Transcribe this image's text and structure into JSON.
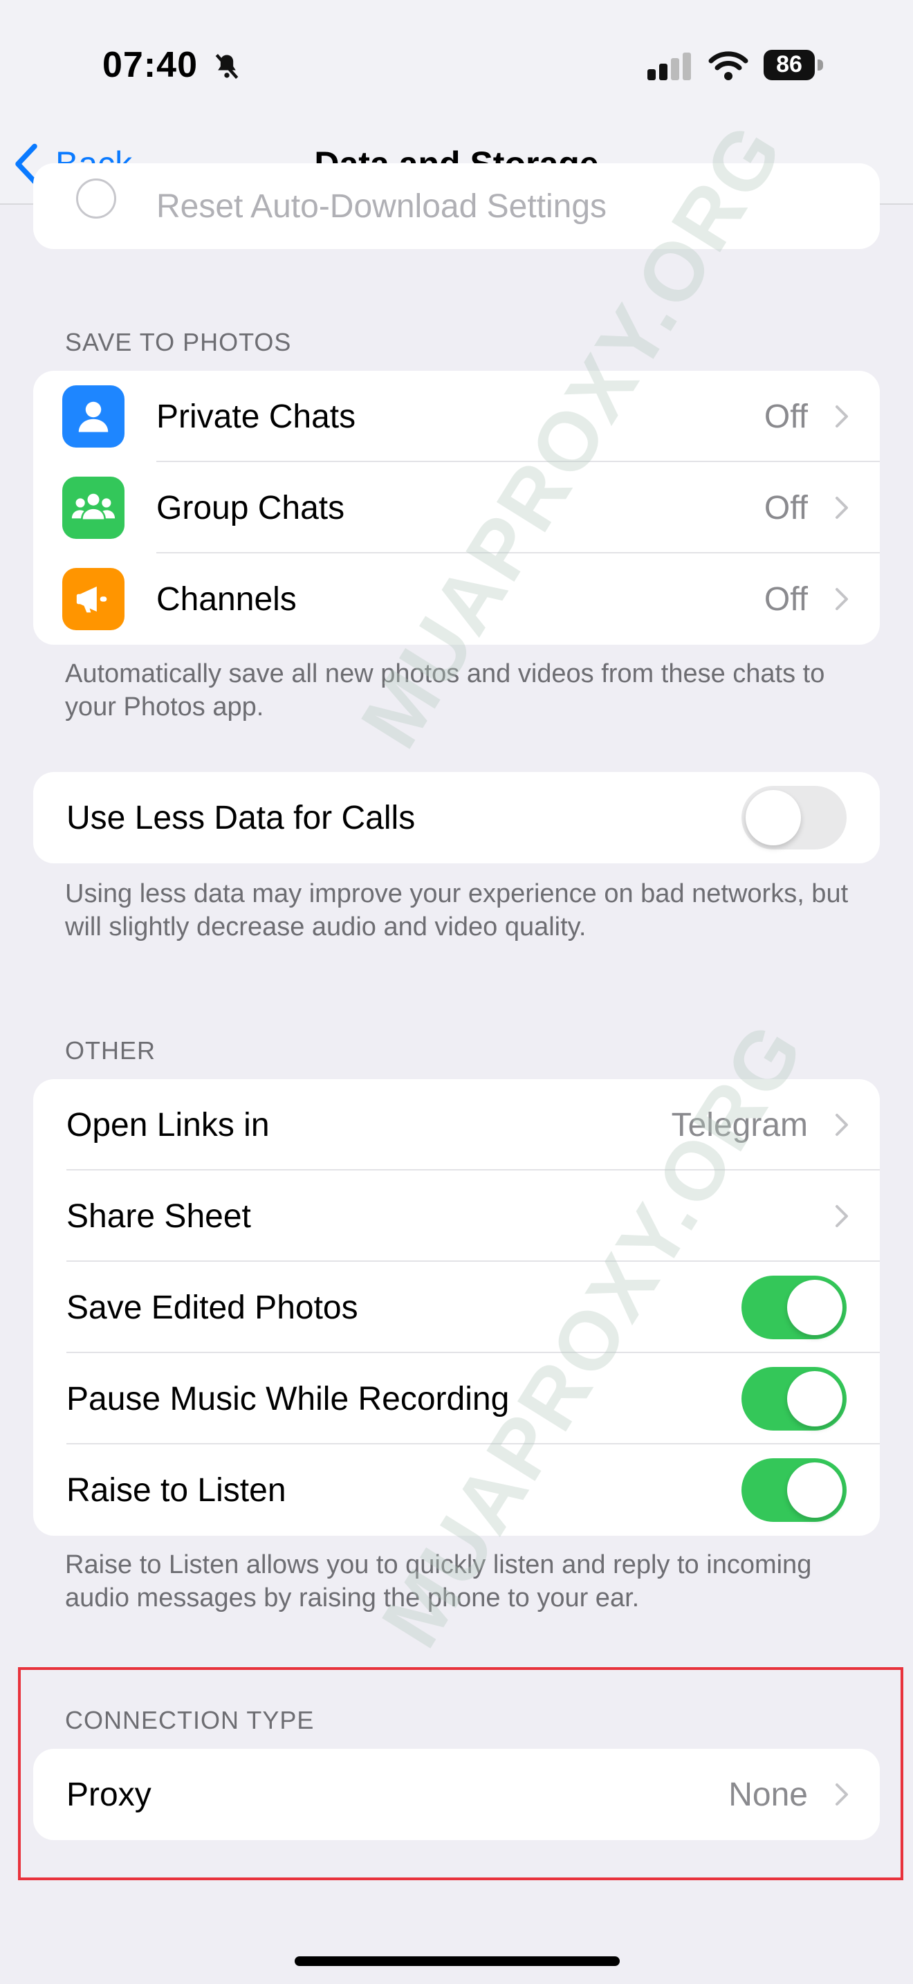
{
  "status_bar": {
    "time": "07:40",
    "battery": "86"
  },
  "nav": {
    "back_label": "Back",
    "title": "Data and Storage"
  },
  "reset_row": {
    "label": "Reset Auto-Download Settings"
  },
  "save_to_photos": {
    "header": "SAVE TO PHOTOS",
    "items": [
      {
        "label": "Private Chats",
        "value": "Off",
        "icon": "person-icon",
        "color": "#1E86FF"
      },
      {
        "label": "Group Chats",
        "value": "Off",
        "icon": "group-icon",
        "color": "#33C75A"
      },
      {
        "label": "Channels",
        "value": "Off",
        "icon": "megaphone-icon",
        "color": "#FF9500"
      }
    ],
    "footer": "Automatically save all new photos and videos from these chats to your Photos app."
  },
  "calls": {
    "label": "Use Less Data for Calls",
    "on": false,
    "footer": "Using less data may improve your experience on bad networks, but will slightly decrease audio and video quality."
  },
  "other": {
    "header": "OTHER",
    "open_links": {
      "label": "Open Links in",
      "value": "Telegram"
    },
    "share_sheet": {
      "label": "Share Sheet"
    },
    "toggles": [
      {
        "label": "Save Edited Photos",
        "on": true
      },
      {
        "label": "Pause Music While Recording",
        "on": true
      },
      {
        "label": "Raise to Listen",
        "on": true
      }
    ],
    "footer": "Raise to Listen allows you to quickly listen and reply to incoming audio messages by raising the phone to your ear."
  },
  "connection": {
    "header": "CONNECTION TYPE",
    "proxy": {
      "label": "Proxy",
      "value": "None"
    }
  },
  "watermark": "MUAPROXY.ORG",
  "colors": {
    "accent": "#0A7AFF",
    "toggle_on": "#34C759",
    "highlight": "#E8323C"
  }
}
